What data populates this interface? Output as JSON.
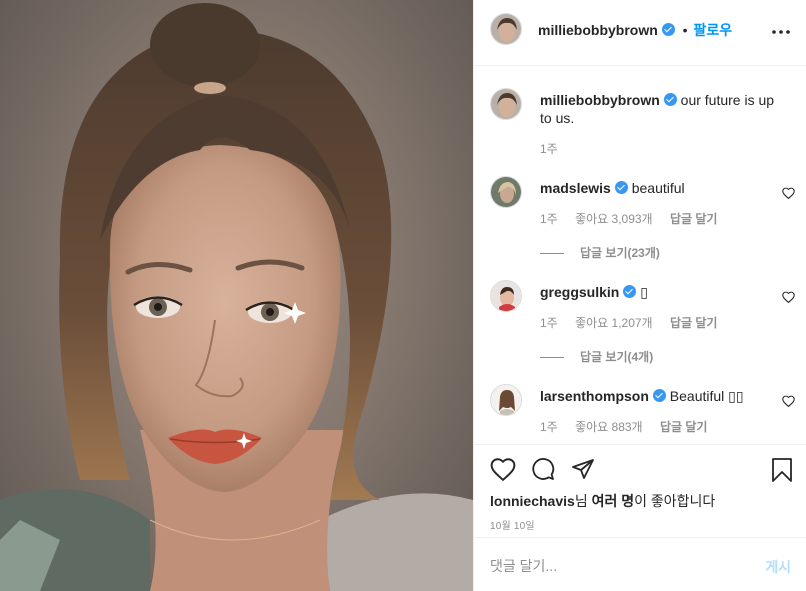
{
  "post": {
    "author": "milliebobbybrown",
    "follow_label": "팔로우",
    "more_icon": "more-horizontal-icon"
  },
  "caption": {
    "author": "milliebobbybrown",
    "text": "our future is up to us.",
    "time": "1주"
  },
  "comments": [
    {
      "author": "madslewis",
      "text": "beautiful",
      "time": "1주",
      "likes": "좋아요 3,093개",
      "reply_label": "답글 달기",
      "view_replies": "답글 보기(23개)"
    },
    {
      "author": "greggsulkin",
      "text": "▯",
      "time": "1주",
      "likes": "좋아요 1,207개",
      "reply_label": "답글 달기",
      "view_replies": "답글 보기(4개)"
    },
    {
      "author": "larsenthompson",
      "text": "Beautiful ▯▯",
      "time": "1주",
      "likes": "좋아요 883개",
      "reply_label": "답글 달기"
    }
  ],
  "likes": {
    "user": "lonniechavis",
    "text_mid": "님 ",
    "others": "여러 명",
    "text_end": "이 좋아합니다"
  },
  "date": "10월 10일",
  "add_comment": {
    "placeholder": "댓글 달기...",
    "post_label": "게시"
  },
  "colors": {
    "accent": "#0095f6",
    "verified": "#3897f0",
    "muted": "#8e8e8e",
    "border": "#efefef"
  }
}
